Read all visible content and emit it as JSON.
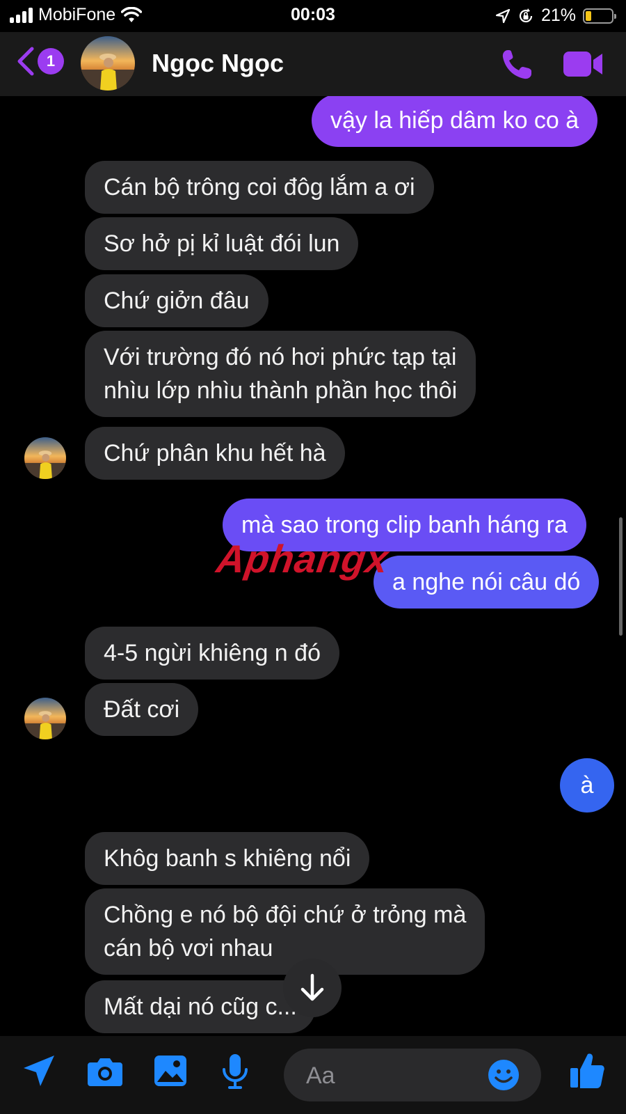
{
  "status_bar": {
    "carrier": "MobiFone",
    "time": "00:03",
    "battery_percent": "21%",
    "battery_level": 0.21,
    "icons": [
      "signal-icon",
      "wifi-icon",
      "location-icon",
      "rotation-lock-icon",
      "battery-icon"
    ]
  },
  "header": {
    "back_badge": "1",
    "contact_name": "Ngọc Ngọc",
    "accent_color": "#9b3cf0",
    "icons": [
      "back-chevron-icon",
      "phone-icon",
      "video-camera-icon"
    ]
  },
  "messages": [
    {
      "side": "out",
      "text": "vậy la hiếp dâm ko co à"
    },
    {
      "side": "in",
      "text": "Cán bộ trông coi đôg lắm a ơi"
    },
    {
      "side": "in",
      "text": "Sơ hở pị kỉ luật đói lun"
    },
    {
      "side": "in",
      "text": "Chứ giởn đâu"
    },
    {
      "side": "in",
      "lines": [
        "Với trường đó nó hơi phức tạp tại",
        "nhìu lớp nhìu thành phần học thôi"
      ]
    },
    {
      "side": "in",
      "text": "Chứ phân khu hết hà"
    },
    {
      "side": "out",
      "text": "mà sao trong clip banh háng ra"
    },
    {
      "side": "out",
      "text": "a nghe nói câu dó"
    },
    {
      "side": "in",
      "text": "4-5 ngừi khiêng n đó"
    },
    {
      "side": "in",
      "text": "Đất cơi"
    },
    {
      "side": "out",
      "text": "à"
    },
    {
      "side": "in",
      "text": "Khôg banh s khiêng nổi"
    },
    {
      "side": "in",
      "lines": [
        "Chồng e nó bộ đội chứ ở trỏng mà",
        "cán bộ vơi nhau"
      ]
    },
    {
      "side": "in",
      "text": "Mất dại nó cũg c..."
    }
  ],
  "watermark": "Aphangx",
  "composer": {
    "placeholder": "Aa",
    "icons": [
      "send-location-icon",
      "camera-icon",
      "image-icon",
      "microphone-icon",
      "emoji-icon",
      "thumbs-up-icon"
    ],
    "icon_color": "#1e88ff"
  }
}
